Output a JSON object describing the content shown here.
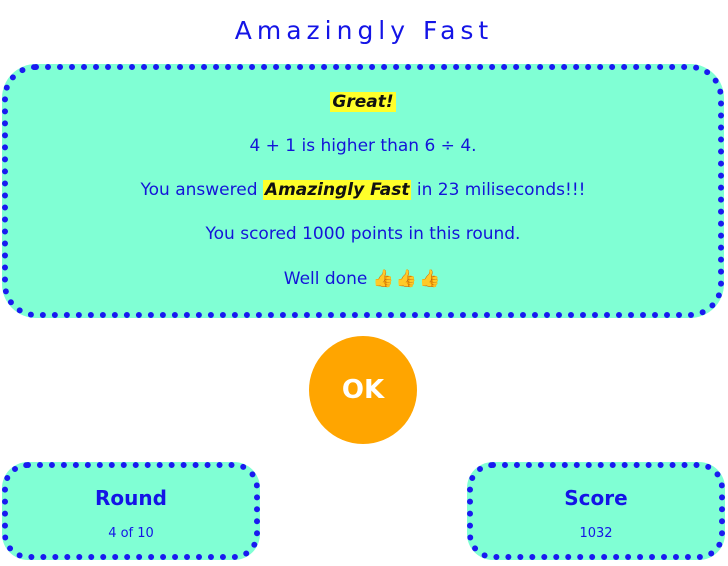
{
  "title": "Amazingly Fast",
  "result": {
    "verdict": "Great!",
    "comparison": "4 + 1 is higher than 6 ÷ 4.",
    "speed_prefix": "You answered ",
    "speed_rating": "Amazingly Fast",
    "speed_suffix": " in 23 miliseconds!!!",
    "points": "You scored 1000 points in this round.",
    "praise": "Well done ",
    "thumbs": "👍👍👍"
  },
  "ok_button": {
    "label": "OK"
  },
  "round": {
    "label": "Round",
    "value": "4 of 10"
  },
  "score": {
    "label": "Score",
    "value": "1032"
  },
  "colors": {
    "panel_bg": "#80ffd4",
    "panel_border": "#1a1af0",
    "highlight": "#ffff2a",
    "ok_button": "#ffa500",
    "text": "#1414e6"
  }
}
